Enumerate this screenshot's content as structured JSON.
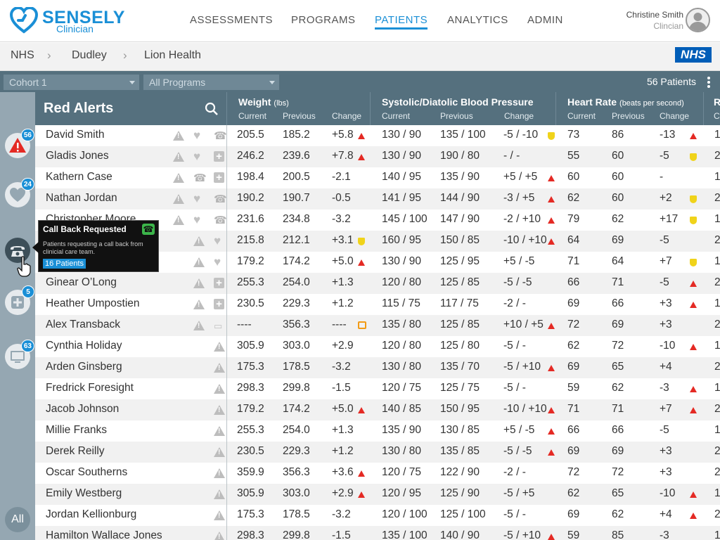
{
  "brand": {
    "name": "SENSELY",
    "subtitle": "Clinician"
  },
  "nav": [
    {
      "label": "ASSESSMENTS",
      "active": false
    },
    {
      "label": "PROGRAMS",
      "active": false
    },
    {
      "label": "PATIENTS",
      "active": true
    },
    {
      "label": "ANALYTICS",
      "active": false
    },
    {
      "label": "ADMIN",
      "active": false
    }
  ],
  "user": {
    "name": "Christine Smith",
    "role": "Clincian"
  },
  "breadcrumb": [
    "NHS",
    "Dudley",
    "Lion Health"
  ],
  "nhs_logo": "NHS",
  "filters": {
    "cohort": "Cohort 1",
    "program": "All Programs",
    "patients_count": "56 Patients"
  },
  "rail": {
    "alerts_badge": "56",
    "heart_badge": "24",
    "plus_badge": "5",
    "device_badge": "63",
    "all_label": "All"
  },
  "table": {
    "title": "Red Alerts",
    "groups": [
      {
        "title": "Weight",
        "unit": "(lbs)"
      },
      {
        "title": "Systolic/Diatolic Blood Pressure",
        "unit": ""
      },
      {
        "title": "Heart Rate",
        "unit": "(beats per second)"
      },
      {
        "title": "R",
        "unit": ""
      }
    ],
    "subheaders": [
      "Current",
      "Previous",
      "Change"
    ],
    "rows": [
      {
        "name": "David Smith",
        "icons": [
          "warn",
          "heart",
          "phone"
        ],
        "w": [
          "205.5",
          "185.2",
          "+5.8"
        ],
        "wf": "red",
        "bp": [
          "130 / 90",
          "135 / 100",
          "-5 / -10"
        ],
        "bpf": "yellow",
        "hr": [
          "73",
          "86",
          "-13"
        ],
        "hrf": "red",
        "r": "1"
      },
      {
        "name": "Gladis Jones",
        "icons": [
          "warn",
          "heart",
          "plus"
        ],
        "w": [
          "246.2",
          "239.6",
          "+7.8"
        ],
        "wf": "red",
        "bp": [
          "130 / 90",
          "190 / 80",
          " - / -"
        ],
        "bpf": "",
        "hr": [
          "55",
          "60",
          "-5"
        ],
        "hrf": "yellow",
        "r": "2"
      },
      {
        "name": "Kathern Case",
        "icons": [
          "warn",
          "phone",
          "plus"
        ],
        "w": [
          "198.4",
          "200.5",
          "-2.1"
        ],
        "wf": "",
        "bp": [
          "140 / 95",
          "135 / 90",
          "+5 / +5"
        ],
        "bpf": "red",
        "hr": [
          "60",
          "60",
          "-"
        ],
        "hrf": "",
        "r": "1"
      },
      {
        "name": "Nathan Jordan",
        "icons": [
          "warn",
          "heart",
          "phone"
        ],
        "w": [
          "190.2",
          "190.7",
          "-0.5"
        ],
        "wf": "",
        "bp": [
          "141 / 95",
          "144 / 90",
          "-3 / +5"
        ],
        "bpf": "red",
        "hr": [
          "62",
          "60",
          "+2"
        ],
        "hrf": "yellow",
        "r": "2"
      },
      {
        "name": "Christopher Moore",
        "icons": [
          "warn",
          "heart",
          "phone"
        ],
        "w": [
          "231.6",
          "234.8",
          "-3.2"
        ],
        "wf": "",
        "bp": [
          "145 / 100",
          "147 / 90",
          "-2 / +10"
        ],
        "bpf": "red",
        "hr": [
          "79",
          "62",
          "+17"
        ],
        "hrf": "yellow",
        "r": "1"
      },
      {
        "name": "",
        "icons": [
          "warn",
          "heart"
        ],
        "w": [
          "215.8",
          "212.1",
          "+3.1"
        ],
        "wf": "yellow",
        "bp": [
          "160 / 95",
          "150 / 85",
          "-10 / +10"
        ],
        "bpf": "red",
        "hr": [
          "64",
          "69",
          "-5"
        ],
        "hrf": "",
        "r": "2"
      },
      {
        "name": "",
        "icons": [
          "warn",
          "heart"
        ],
        "w": [
          "179.2",
          "174.2",
          "+5.0"
        ],
        "wf": "red",
        "bp": [
          "130 / 90",
          "125 / 95",
          "+5 / -5"
        ],
        "bpf": "",
        "hr": [
          "71",
          "64",
          "+7"
        ],
        "hrf": "yellow",
        "r": "1"
      },
      {
        "name": "Ginear O’Long",
        "icons": [
          "warn",
          "plus"
        ],
        "w": [
          "255.3",
          "254.0",
          "+1.3"
        ],
        "wf": "",
        "bp": [
          "120 / 80",
          "125 / 85",
          "-5 / -5"
        ],
        "bpf": "",
        "hr": [
          "66",
          "71",
          "-5"
        ],
        "hrf": "red",
        "r": "2"
      },
      {
        "name": "Heather Umpostien",
        "icons": [
          "warn",
          "plus"
        ],
        "w": [
          "230.5",
          "229.3",
          "+1.2"
        ],
        "wf": "",
        "bp": [
          "115 / 75",
          "117 / 75",
          "-2 / -"
        ],
        "bpf": "",
        "hr": [
          "69",
          "66",
          "+3"
        ],
        "hrf": "red",
        "r": "1"
      },
      {
        "name": "Alex Transback",
        "icons": [
          "warn",
          "device"
        ],
        "w": [
          "----",
          "356.3",
          "----"
        ],
        "wf": "orange",
        "bp": [
          "135 / 80",
          "125 / 85",
          "+10 / +5"
        ],
        "bpf": "red",
        "hr": [
          "72",
          "69",
          "+3"
        ],
        "hrf": "",
        "r": "2"
      },
      {
        "name": "Cynthia Holiday",
        "icons": [
          "warn"
        ],
        "w": [
          "305.9",
          "303.0",
          "+2.9"
        ],
        "wf": "",
        "bp": [
          "120 / 80",
          "125 / 80",
          "-5 / -"
        ],
        "bpf": "",
        "hr": [
          "62",
          "72",
          "-10"
        ],
        "hrf": "red",
        "r": "1"
      },
      {
        "name": "Arden Ginsberg",
        "icons": [
          "warn"
        ],
        "w": [
          "175.3",
          "178.5",
          "-3.2"
        ],
        "wf": "",
        "bp": [
          "130 / 80",
          "135 / 70",
          "-5 / +10"
        ],
        "bpf": "red",
        "hr": [
          "69",
          "65",
          "+4"
        ],
        "hrf": "",
        "r": "2"
      },
      {
        "name": "Fredrick Foresight",
        "icons": [
          "warn"
        ],
        "w": [
          "298.3",
          "299.8",
          "-1.5"
        ],
        "wf": "",
        "bp": [
          "120 / 75",
          "125 / 75",
          "-5 / -"
        ],
        "bpf": "",
        "hr": [
          "59",
          "62",
          "-3"
        ],
        "hrf": "red",
        "r": "1"
      },
      {
        "name": "Jacob Johnson",
        "icons": [
          "warn"
        ],
        "w": [
          "179.2",
          "174.2",
          "+5.0"
        ],
        "wf": "red",
        "bp": [
          "140 / 85",
          "150 / 95",
          "-10 / +10"
        ],
        "bpf": "red",
        "hr": [
          "71",
          "71",
          "+7"
        ],
        "hrf": "red",
        "r": "2"
      },
      {
        "name": "Millie Franks",
        "icons": [
          "warn"
        ],
        "w": [
          "255.3",
          "254.0",
          "+1.3"
        ],
        "wf": "",
        "bp": [
          "135 / 90",
          "130 / 85",
          "+5 / -5"
        ],
        "bpf": "red",
        "hr": [
          "66",
          "66",
          "-5"
        ],
        "hrf": "",
        "r": "1"
      },
      {
        "name": "Derek Reilly",
        "icons": [
          "warn"
        ],
        "w": [
          "230.5",
          "229.3",
          "+1.2"
        ],
        "wf": "",
        "bp": [
          "130 / 80",
          "135 / 85",
          "-5 / -5"
        ],
        "bpf": "red",
        "hr": [
          "69",
          "69",
          "+3"
        ],
        "hrf": "",
        "r": "2"
      },
      {
        "name": "Oscar Southerns",
        "icons": [
          "warn"
        ],
        "w": [
          "359.9",
          "356.3",
          "+3.6"
        ],
        "wf": "red",
        "bp": [
          "120 / 75",
          "122 / 90",
          "-2 / -"
        ],
        "bpf": "",
        "hr": [
          "72",
          "72",
          "+3"
        ],
        "hrf": "",
        "r": "2"
      },
      {
        "name": "Emily Westberg",
        "icons": [
          "warn"
        ],
        "w": [
          "305.9",
          "303.0",
          "+2.9"
        ],
        "wf": "red",
        "bp": [
          "120 / 95",
          "125 / 90",
          "-5 / +5"
        ],
        "bpf": "",
        "hr": [
          "62",
          "65",
          "-10"
        ],
        "hrf": "red",
        "r": "1"
      },
      {
        "name": "Jordan Kellionburg",
        "icons": [
          "warn"
        ],
        "w": [
          "175.3",
          "178.5",
          "-3.2"
        ],
        "wf": "",
        "bp": [
          "120 / 100",
          "125 / 100",
          "-5 / -"
        ],
        "bpf": "",
        "hr": [
          "69",
          "62",
          "+4"
        ],
        "hrf": "red",
        "r": "2"
      },
      {
        "name": "Hamilton Wallace Jones",
        "icons": [
          "warn"
        ],
        "w": [
          "298.3",
          "299.8",
          "-1.5"
        ],
        "wf": "",
        "bp": [
          "135 / 100",
          "140 / 90",
          "-5 / +10"
        ],
        "bpf": "red",
        "hr": [
          "59",
          "85",
          "-3"
        ],
        "hrf": "",
        "r": "1"
      }
    ]
  },
  "tooltip": {
    "title": "Call Back Requested",
    "description": "Patients requesting a call back from clinicial care team.",
    "link": "16 Patients"
  },
  "colors": {
    "accent": "#1a8fd6",
    "header": "#55707e",
    "alert_red": "#e42a24",
    "warn_yellow": "#f0d31a"
  }
}
